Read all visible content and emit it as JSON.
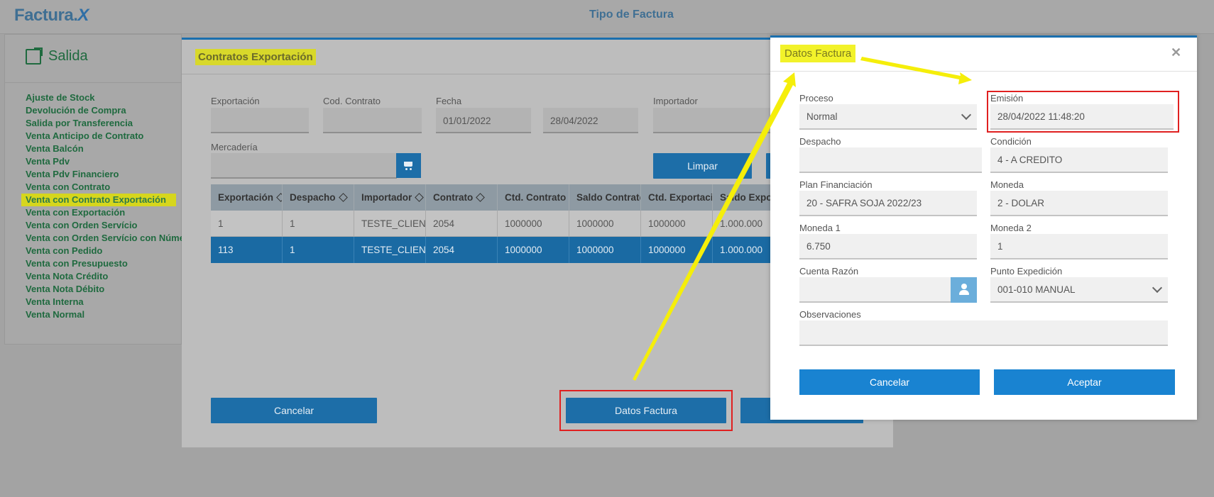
{
  "app": {
    "logo_text": "Factura",
    "logo_x": "X",
    "page_title": "Tipo de Factura"
  },
  "sidebar": {
    "section_title": "Salida",
    "items": [
      "Ajuste de Stock",
      "Devolución de Compra",
      "Salida por Transferencia",
      "Venta Anticipo de Contrato",
      "Venta Balcón",
      "Venta Pdv",
      "Venta Pdv Financiero",
      "Venta con Contrato",
      "Venta con Contrato Exportación",
      "Venta con Exportación",
      "Venta con Orden Servício",
      "Venta con Orden Servício con Núme",
      "Venta con Pedido",
      "Venta con Presupuesto",
      "Venta Nota Crédito",
      "Venta Nota Débito",
      "Venta Interna",
      "Venta Normal"
    ],
    "selected_index": 8
  },
  "contratos": {
    "title": "Contratos Exportación",
    "filters": {
      "exportacion_label": "Exportación",
      "exportacion_value": "",
      "cod_contrato_label": "Cod. Contrato",
      "cod_contrato_value": "",
      "fecha_label": "Fecha",
      "fecha_desde": "01/01/2022",
      "fecha_hasta": "28/04/2022",
      "importador_label": "Importador",
      "importador_value": "",
      "mercaderia_label": "Mercadería",
      "mercaderia_value": "",
      "cart_icon": "shopping-cart-icon",
      "limpiar_label": "Limpar"
    },
    "table": {
      "headers": [
        "Exportación",
        "Despacho",
        "Importador",
        "Contrato",
        "Ctd. Contrato",
        "Saldo Contrato",
        "Ctd. Exportació",
        "Saldo Expo"
      ],
      "rows": [
        [
          "1",
          "1",
          "TESTE_CLIENT",
          "2054",
          "1000000",
          "1000000",
          "1000000",
          "1.000.000"
        ],
        [
          "113",
          "1",
          "TESTE_CLIENT",
          "2054",
          "1000000",
          "1000000",
          "1000000",
          "1.000.000"
        ]
      ],
      "selected_row": 1
    },
    "cancelar_label": "Cancelar",
    "datos_factura_label": "Datos Factura"
  },
  "datos_factura": {
    "title": "Datos Factura",
    "close_icon": "close-icon",
    "proceso_label": "Proceso",
    "proceso_value": "Normal",
    "emision_label": "Emisión",
    "emision_value": "28/04/2022 11:48:20",
    "despacho_label": "Despacho",
    "despacho_value": "",
    "condicion_label": "Condición",
    "condicion_value": "4 - A CREDITO",
    "plan_label": "Plan Financiación",
    "plan_value": "20 - SAFRA SOJA 2022/23",
    "moneda_label": "Moneda",
    "moneda_value": "2 - DOLAR",
    "moneda1_label": "Moneda 1",
    "moneda1_value": "6.750",
    "moneda2_label": "Moneda 2",
    "moneda2_value": "1",
    "cuenta_label": "Cuenta Razón",
    "cuenta_value": "",
    "user_icon": "user-icon",
    "punto_label": "Punto Expedición",
    "punto_value": "001-010 MANUAL",
    "obs_label": "Observaciones",
    "obs_value": "",
    "cancelar_label": "Cancelar",
    "aceptar_label": "Aceptar"
  },
  "colors": {
    "accent": "#1983d1",
    "highlight": "#f2f22a",
    "annotation_red": "#e02020",
    "menu_green": "#1f6a3f"
  }
}
